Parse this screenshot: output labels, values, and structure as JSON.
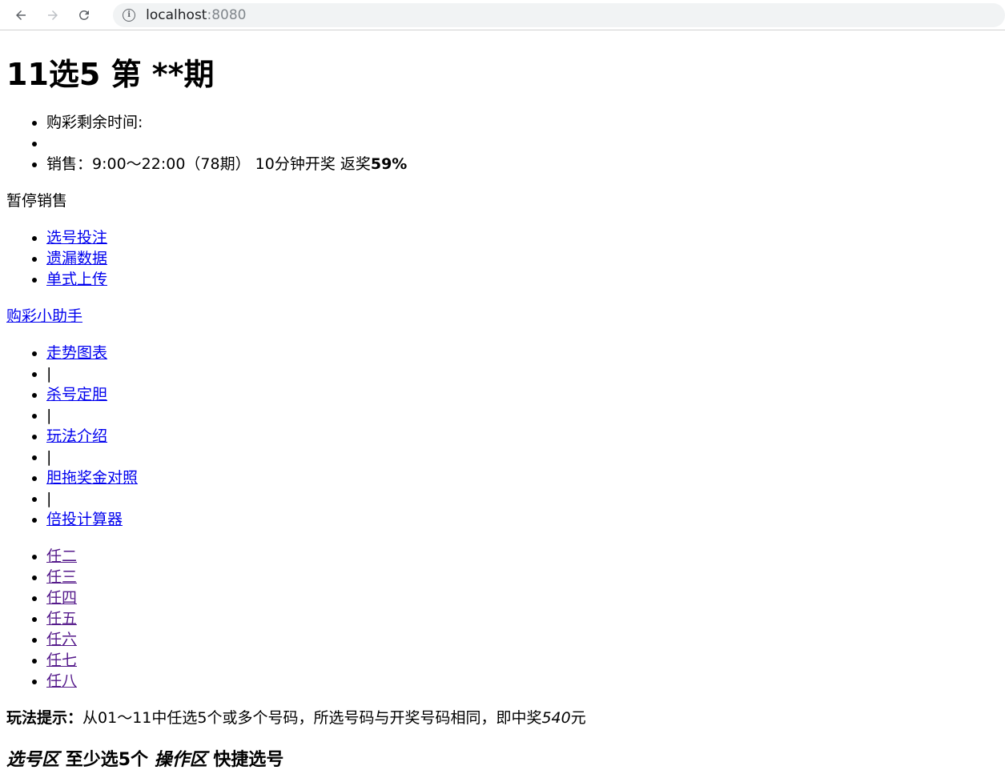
{
  "browser": {
    "url_host": "localhost",
    "url_port": ":8080"
  },
  "header": {
    "title_prefix": "11选5 第",
    "title_em": "**",
    "title_suffix": "期"
  },
  "info_list": {
    "time_label": "购彩剩余时间:",
    "empty_item": "",
    "sales_text": "销售：9:00～22:00（78期） 10分钟开奖 返奖",
    "sales_bold": "59%"
  },
  "status_text": "暂停销售",
  "main_tabs": [
    "选号投注",
    "遗漏数据",
    "单式上传"
  ],
  "helper_link": "购彩小助手",
  "tools": [
    {
      "label": "走势图表"
    },
    {
      "label": "杀号定胆"
    },
    {
      "label": "玩法介绍"
    },
    {
      "label": "胆拖奖金对照"
    },
    {
      "label": "倍投计算器"
    }
  ],
  "tool_separator": "|",
  "play_types": [
    "任二",
    "任三",
    "任四",
    "任五",
    "任六",
    "任七",
    "任八"
  ],
  "hint": {
    "label": "玩法提示：",
    "text": "从01～11中任选5个或多个号码，所选号码与开奖号码相同，即中奖",
    "prize": "540",
    "unit": "元"
  },
  "section": {
    "pick_zone": "选号区",
    "min_pick": "至少选5个",
    "op_zone": "操作区",
    "quick_pick": "快捷选号"
  }
}
